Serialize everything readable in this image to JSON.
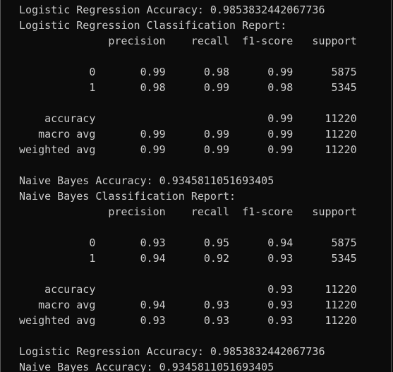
{
  "terminal": {
    "lines": [
      "Logistic Regression Accuracy: 0.9853832442067736",
      "Logistic Regression Classification Report:",
      "              precision    recall  f1-score   support",
      "",
      "           0       0.99      0.98      0.99      5875",
      "           1       0.98      0.99      0.98      5345",
      "",
      "    accuracy                           0.99     11220",
      "   macro avg       0.99      0.99      0.99     11220",
      "weighted avg       0.99      0.99      0.99     11220",
      "",
      "Naive Bayes Accuracy: 0.9345811051693405",
      "Naive Bayes Classification Report:",
      "              precision    recall  f1-score   support",
      "",
      "           0       0.93      0.95      0.94      5875",
      "           1       0.94      0.92      0.93      5345",
      "",
      "    accuracy                           0.93     11220",
      "   macro avg       0.94      0.93      0.93     11220",
      "weighted avg       0.93      0.93      0.93     11220",
      "",
      "Logistic Regression Accuracy: 0.9853832442067736",
      "Naive Bayes Accuracy: 0.9345811051693405"
    ]
  }
}
